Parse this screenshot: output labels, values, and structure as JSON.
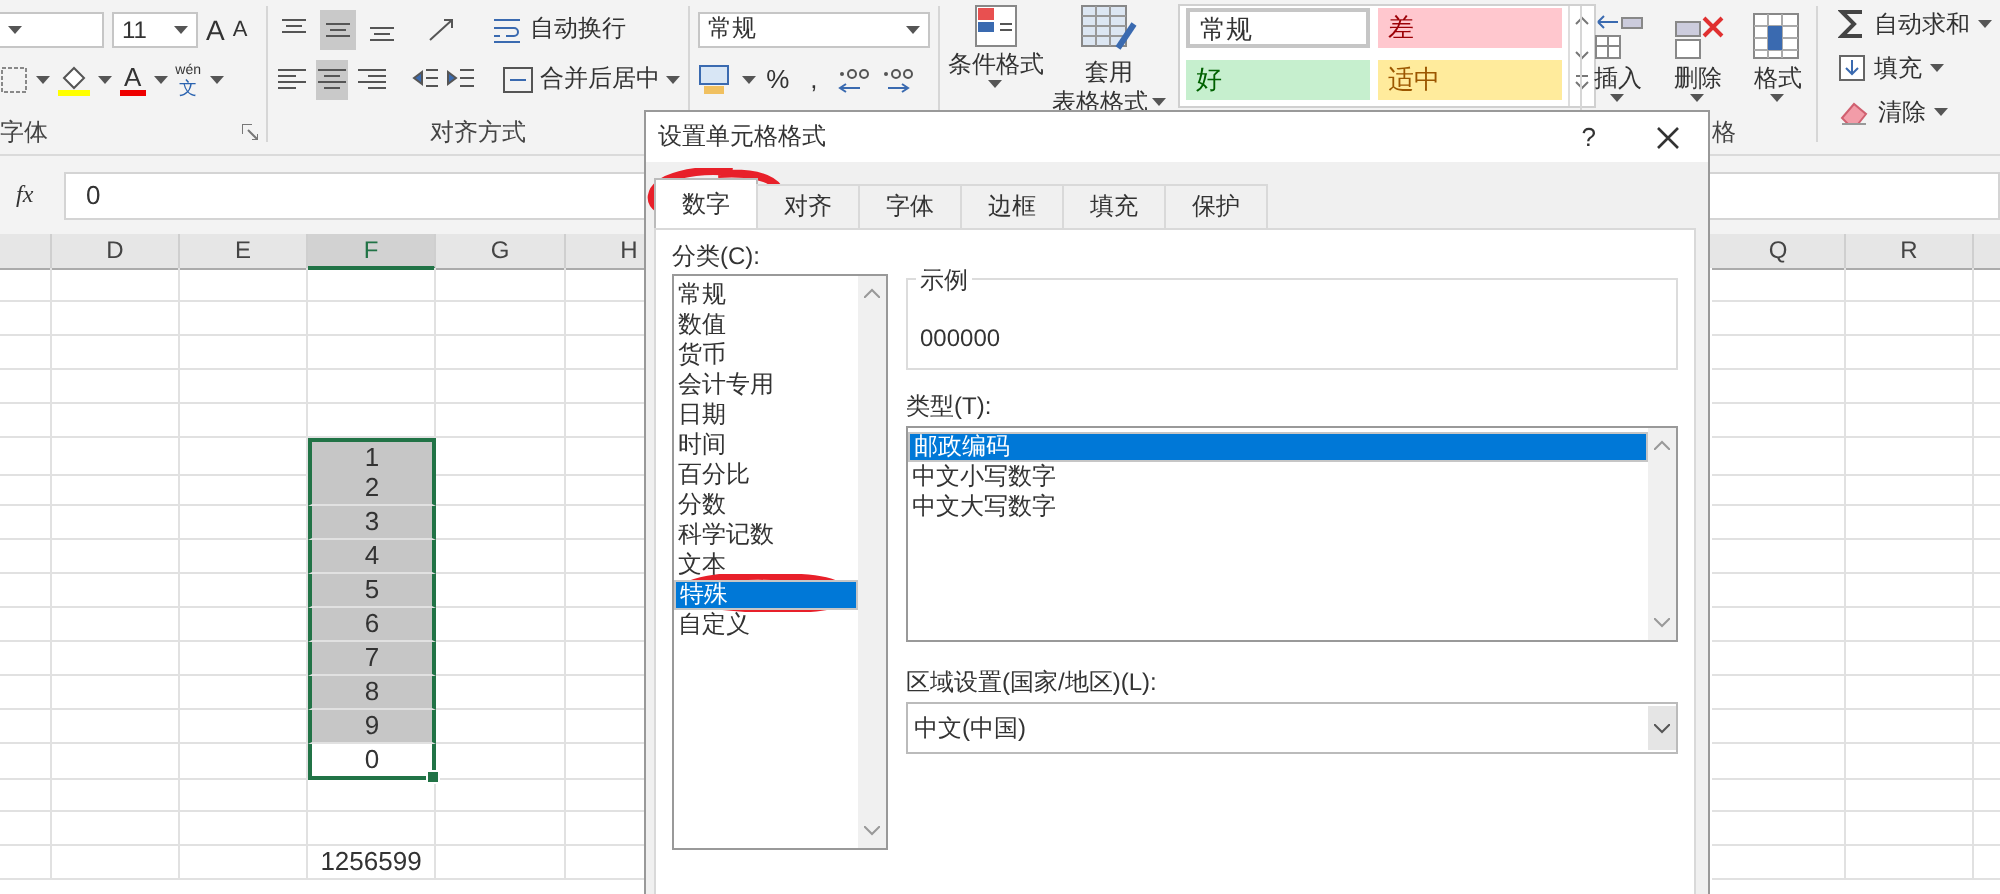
{
  "ribbon": {
    "font_group": {
      "label": "字体",
      "size": "11",
      "grow_glyph": "A",
      "shrink_glyph": "A",
      "font_color_glyph": "A",
      "phonetic_top": "wén",
      "phonetic_bottom": "文"
    },
    "align_group": {
      "label": "对齐方式",
      "vertical": [
        {
          "kind": "top",
          "selected": false
        },
        {
          "kind": "middle",
          "selected": true
        },
        {
          "kind": "bottom",
          "selected": false
        }
      ],
      "horizontal": [
        {
          "kind": "left",
          "selected": false
        },
        {
          "kind": "center",
          "selected": true
        },
        {
          "kind": "right",
          "selected": false
        }
      ],
      "wrap": "自动换行",
      "merge": "合并后居中"
    },
    "number_group": {
      "format": "常规",
      "percent": "%",
      "comma": ","
    },
    "styles_group": {
      "conditional": "条件格式",
      "table_top": "套用",
      "table_bottom": "表格格式",
      "styles": [
        {
          "label": "常规",
          "kind": "normal"
        },
        {
          "label": "差",
          "kind": "bad"
        },
        {
          "label": "好",
          "kind": "good"
        },
        {
          "label": "适中",
          "kind": "neutral"
        }
      ]
    },
    "cells_group": {
      "label": "格",
      "buttons": [
        {
          "kind": "insert",
          "label": "插入"
        },
        {
          "kind": "delete",
          "label": "删除"
        },
        {
          "kind": "format",
          "label": "格式"
        }
      ]
    },
    "editing_group": {
      "items": [
        {
          "kind": "sum",
          "label": "自动求和"
        },
        {
          "kind": "fill",
          "label": "填充"
        },
        {
          "kind": "clear",
          "label": "清除"
        }
      ]
    }
  },
  "formula_bar": {
    "fx": "fx",
    "value": "0"
  },
  "sheet": {
    "columns": [
      {
        "label": "D",
        "selected": false
      },
      {
        "label": "E",
        "selected": false
      },
      {
        "label": "F",
        "selected": true
      },
      {
        "label": "G",
        "selected": false
      },
      {
        "label": "H",
        "selected": false
      },
      {
        "label": "Q",
        "selected": false
      },
      {
        "label": "R",
        "selected": false
      }
    ],
    "column_f_cells": [
      {
        "value": "1",
        "selected": true,
        "active": false
      },
      {
        "value": "2",
        "selected": true,
        "active": false
      },
      {
        "value": "3",
        "selected": true,
        "active": false
      },
      {
        "value": "4",
        "selected": true,
        "active": false
      },
      {
        "value": "5",
        "selected": true,
        "active": false
      },
      {
        "value": "6",
        "selected": true,
        "active": false
      },
      {
        "value": "7",
        "selected": true,
        "active": false
      },
      {
        "value": "8",
        "selected": true,
        "active": false
      },
      {
        "value": "9",
        "selected": true,
        "active": false
      },
      {
        "value": "0",
        "selected": true,
        "active": true
      },
      {
        "value": "1256599",
        "selected": false,
        "active": false
      }
    ]
  },
  "dialog": {
    "title": "设置单元格格式",
    "help": "?",
    "tabs": [
      {
        "label": "数字",
        "selected": true
      },
      {
        "label": "对齐",
        "selected": false
      },
      {
        "label": "字体",
        "selected": false
      },
      {
        "label": "边框",
        "selected": false
      },
      {
        "label": "填充",
        "selected": false
      },
      {
        "label": "保护",
        "selected": false
      }
    ],
    "category_label": "分类(C):",
    "categories": [
      {
        "label": "常规",
        "selected": false
      },
      {
        "label": "数值",
        "selected": false
      },
      {
        "label": "货币",
        "selected": false
      },
      {
        "label": "会计专用",
        "selected": false
      },
      {
        "label": "日期",
        "selected": false
      },
      {
        "label": "时间",
        "selected": false
      },
      {
        "label": "百分比",
        "selected": false
      },
      {
        "label": "分数",
        "selected": false
      },
      {
        "label": "科学记数",
        "selected": false
      },
      {
        "label": "文本",
        "selected": false
      },
      {
        "label": "特殊",
        "selected": true
      },
      {
        "label": "自定义",
        "selected": false
      }
    ],
    "sample_label": "示例",
    "sample_value": "000000",
    "type_label": "类型(T):",
    "types": [
      {
        "label": "邮政编码",
        "selected": true
      },
      {
        "label": "中文小写数字",
        "selected": false
      },
      {
        "label": "中文大写数字",
        "selected": false
      }
    ],
    "locale_label": "区域设置(国家/地区)(L):",
    "locale_value": "中文(中国)"
  },
  "annotations": [
    {
      "kind": "circle"
    },
    {
      "kind": "circle"
    }
  ]
}
